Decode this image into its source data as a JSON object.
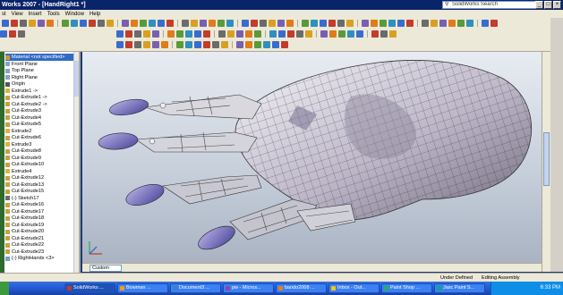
{
  "window": {
    "title": "Works 2007 - [HandRight1 *]",
    "search_text": "SolidWorks Search",
    "controls": [
      "_",
      "□",
      "×"
    ]
  },
  "menubar": [
    "st",
    "View",
    "Insert",
    "Tools",
    "Window",
    "Help"
  ],
  "toolbar": {
    "icon_colors": [
      "#3a6ccf",
      "#d9a020",
      "#5a9a3a",
      "#c33c2c",
      "#7a5fb0",
      "#2f8fbf",
      "#6b6b6b",
      "#e07c1a"
    ]
  },
  "feature_tree": {
    "items": [
      {
        "label": "Material <not specified>",
        "icon": "material-icon",
        "selected": true
      },
      {
        "label": "Front Plane",
        "icon": "plane-icon"
      },
      {
        "label": "Top Plane",
        "icon": "plane-icon"
      },
      {
        "label": "Right Plane",
        "icon": "plane-icon"
      },
      {
        "label": "Origin",
        "icon": "origin-icon"
      },
      {
        "label": "Extrude1 ->",
        "icon": "extrude-icon"
      },
      {
        "label": "Cut-Extrude1 ->",
        "icon": "cut-icon"
      },
      {
        "label": "Cut-Extrude2 ->",
        "icon": "cut-icon"
      },
      {
        "label": "Cut-Extrude3",
        "icon": "cut-icon"
      },
      {
        "label": "Cut-Extrude4",
        "icon": "cut-icon"
      },
      {
        "label": "Cut-Extrude5",
        "icon": "cut-icon"
      },
      {
        "label": "Extrude2",
        "icon": "extrude-icon"
      },
      {
        "label": "Cut-Extrude6",
        "icon": "cut-icon"
      },
      {
        "label": "Extrude3",
        "icon": "extrude-icon"
      },
      {
        "label": "Cut-Extrude8",
        "icon": "cut-icon"
      },
      {
        "label": "Cut-Extrude9",
        "icon": "cut-icon"
      },
      {
        "label": "Cut-Extrude10",
        "icon": "cut-icon"
      },
      {
        "label": "Extrude4",
        "icon": "extrude-icon"
      },
      {
        "label": "Cut-Extrude12",
        "icon": "cut-icon"
      },
      {
        "label": "Cut-Extrude13",
        "icon": "cut-icon"
      },
      {
        "label": "Cut-Extrude15",
        "icon": "cut-icon"
      },
      {
        "label": "(-) Sketch17",
        "icon": "sketch-icon"
      },
      {
        "label": "Cut-Extrude16",
        "icon": "cut-icon"
      },
      {
        "label": "Cut-Extrude17",
        "icon": "cut-icon"
      },
      {
        "label": "Cut-Extrude18",
        "icon": "cut-icon"
      },
      {
        "label": "Cut-Extrude19",
        "icon": "cut-icon"
      },
      {
        "label": "Cut-Extrude20",
        "icon": "cut-icon"
      },
      {
        "label": "Cut-Extrude21",
        "icon": "cut-icon"
      },
      {
        "label": "Cut-Extrude22",
        "icon": "cut-icon"
      },
      {
        "label": "Cut-Extrude23",
        "icon": "cut-icon"
      },
      {
        "label": "(-) RightHands <3>",
        "icon": "part-icon"
      }
    ]
  },
  "viewport": {
    "tab_label": "Custom"
  },
  "statusbar": {
    "left": "",
    "definition": "Under Defined",
    "mode": "Editing Assembly",
    "help": ""
  },
  "taskbar": {
    "buttons": [
      {
        "label": "SolidWorks ...",
        "active": true,
        "color": "#c0392b"
      },
      {
        "label": "Bowman ...",
        "active": false,
        "color": "#f39c12"
      },
      {
        "label": "Document3 ...",
        "active": false,
        "color": "#2e86c1"
      },
      {
        "label": "pw - Micros...",
        "active": false,
        "color": "#8e44ad"
      },
      {
        "label": "bando2008 ...",
        "active": false,
        "color": "#e67e22"
      },
      {
        "label": "Inbox - Out...",
        "active": false,
        "color": "#f1c40f"
      },
      {
        "label": "Paint Shop ...",
        "active": false,
        "color": "#27ae60"
      },
      {
        "label": "Jasc Paint S...",
        "active": false,
        "color": "#16a085"
      }
    ],
    "clock": "6:33 PM"
  }
}
